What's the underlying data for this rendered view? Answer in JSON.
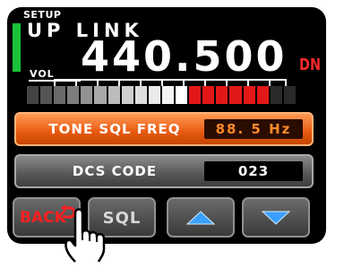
{
  "header": {
    "mode_label": "SETUP",
    "band_label": "UP LINK",
    "volume_label": "VOL",
    "frequency": "440.500",
    "mode_indicator": "DN"
  },
  "meter": {
    "segments": [
      "#444444",
      "#555555",
      "#6a6a6a",
      "#7e7e7e",
      "#939393",
      "#a8a8a8",
      "#bcbcbc",
      "#cfcfcf",
      "#dedede",
      "#eaeaea",
      "#f4f4f4",
      "#ffffff",
      "#e21818",
      "#e21818",
      "#e21818",
      "#e21818",
      "#e21818",
      "#e21818",
      "#2a2a2a",
      "#2a2a2a"
    ]
  },
  "settings": {
    "tone_label": "TONE SQL FREQ",
    "tone_value": "88. 5 Hz",
    "dcs_label": "DCS CODE",
    "dcs_value": "023"
  },
  "softkeys": {
    "back_label": "BACK",
    "sql_label": "SQL"
  },
  "icons": {
    "back": "return-arrow-icon",
    "up": "up-arrow-icon",
    "down": "down-arrow-icon",
    "pointer": "pointing-hand-icon"
  },
  "colors": {
    "accent": "#e85a10",
    "meter_peak": "#e21818",
    "arrow": "#3aa0ff",
    "status_indicator": "#19c23a"
  }
}
